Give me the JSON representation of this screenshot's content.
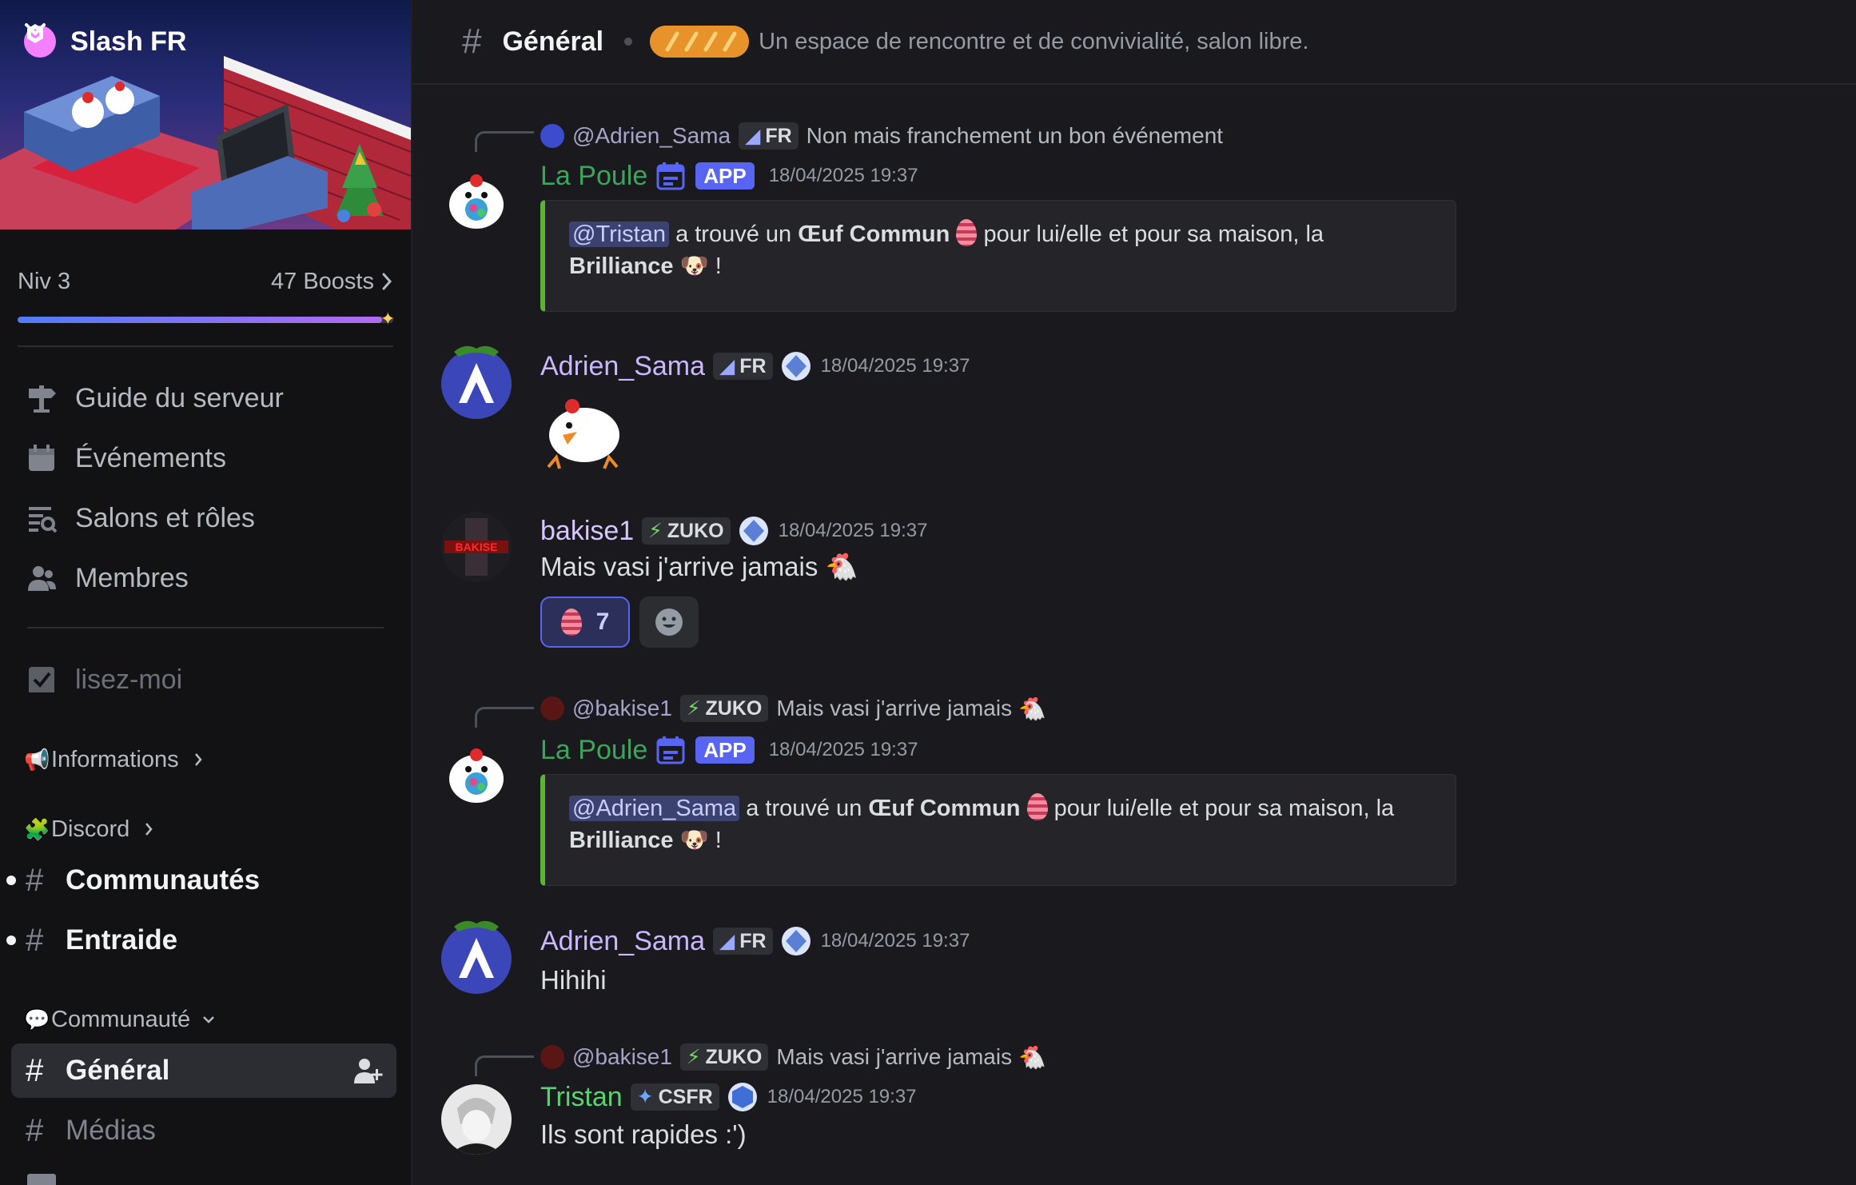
{
  "server": {
    "name": "Slash FR",
    "level_label": "Niv 3",
    "boosts_label": "47 Boosts",
    "boost_progress": 0.97
  },
  "nav": {
    "guide": "Guide du serveur",
    "events": "Événements",
    "channels_roles": "Salons et rôles",
    "members": "Membres",
    "readme": "lisez-moi"
  },
  "categories": {
    "informations": "Informations",
    "discord": "Discord",
    "communaute": "Communauté"
  },
  "channels": {
    "communautes": "Communautés",
    "entraide": "Entraide",
    "general": "Général",
    "medias": "Médias"
  },
  "topbar": {
    "channel": "Général",
    "topic": "Un espace de rencontre et de convivialité, salon libre."
  },
  "messages": [
    {
      "reply_to": "@Adrien_Sama",
      "reply_tag": "FR",
      "reply_text": "Non mais franchement un bon événement",
      "author": "La Poule",
      "app_tag": "APP",
      "time": "18/04/2025 19:37",
      "embed_mention": "@Tristan",
      "embed_text_1": "a trouvé un",
      "embed_bold": "Œuf Commun",
      "embed_text_2": "pour lui/elle et pour sa maison, la",
      "embed_house": "Brilliance",
      "embed_end": "!"
    },
    {
      "author": "Adrien_Sama",
      "tag": "FR",
      "time": "18/04/2025 19:37"
    },
    {
      "author": "bakise1",
      "tag": "ZUKO",
      "time": "18/04/2025 19:37",
      "text": "Mais vasi j'arrive jamais",
      "reaction_count": "7"
    },
    {
      "reply_to": "@bakise1",
      "reply_tag": "ZUKO",
      "reply_text": "Mais vasi j'arrive jamais",
      "author": "La Poule",
      "app_tag": "APP",
      "time": "18/04/2025 19:37",
      "embed_mention": "@Adrien_Sama",
      "embed_text_1": "a trouvé un",
      "embed_bold": "Œuf Commun",
      "embed_text_2": "pour lui/elle et pour sa maison, la",
      "embed_house": "Brilliance",
      "embed_end": "!"
    },
    {
      "author": "Adrien_Sama",
      "tag": "FR",
      "time": "18/04/2025 19:37",
      "text": "Hihihi"
    },
    {
      "reply_to": "@bakise1",
      "reply_tag": "ZUKO",
      "reply_text": "Mais vasi j'arrive jamais",
      "author": "Tristan",
      "tag": "CSFR",
      "time": "18/04/2025 19:37",
      "text": "Ils sont rapides :')"
    }
  ],
  "colors": {
    "bot_name": "#3ba55c",
    "adrien_name": "#c9b8ff",
    "bakise_name": "#d8c6ff",
    "tristan_name": "#57d46f",
    "accent": "#5865f2",
    "embed_bar": "#5bb535"
  }
}
